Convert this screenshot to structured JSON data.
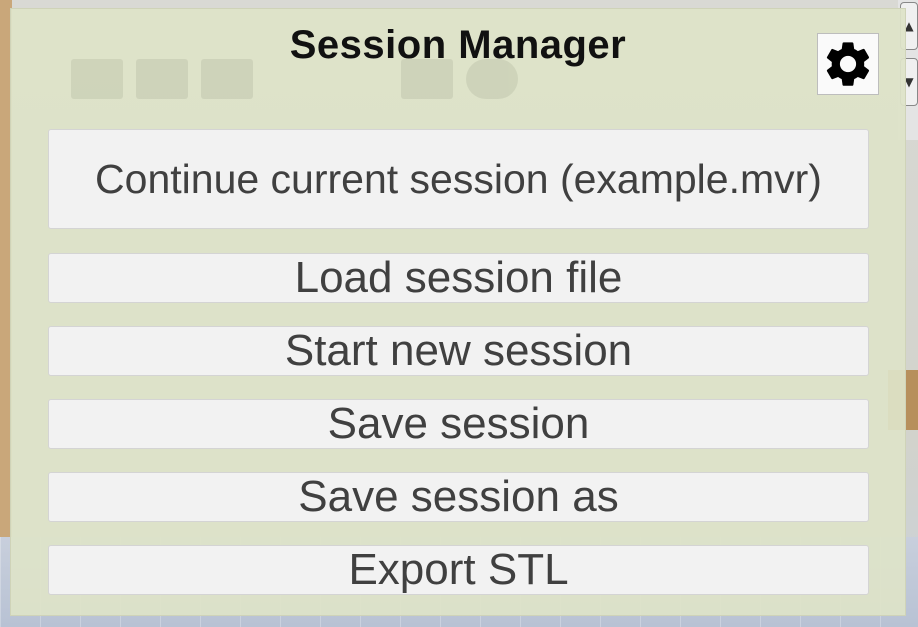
{
  "dialog": {
    "title": "Session Manager",
    "settings_icon": "gear-icon"
  },
  "buttons": {
    "continue": "Continue current session (example.mvr)",
    "load": "Load session file",
    "new": "Start new session",
    "save": "Save session",
    "save_as": "Save session as",
    "export_stl": "Export STL"
  },
  "colors": {
    "panel_bg": "#dee3c8",
    "button_bg": "#f2f2f2",
    "button_text": "#404040",
    "title_text": "#111111"
  }
}
